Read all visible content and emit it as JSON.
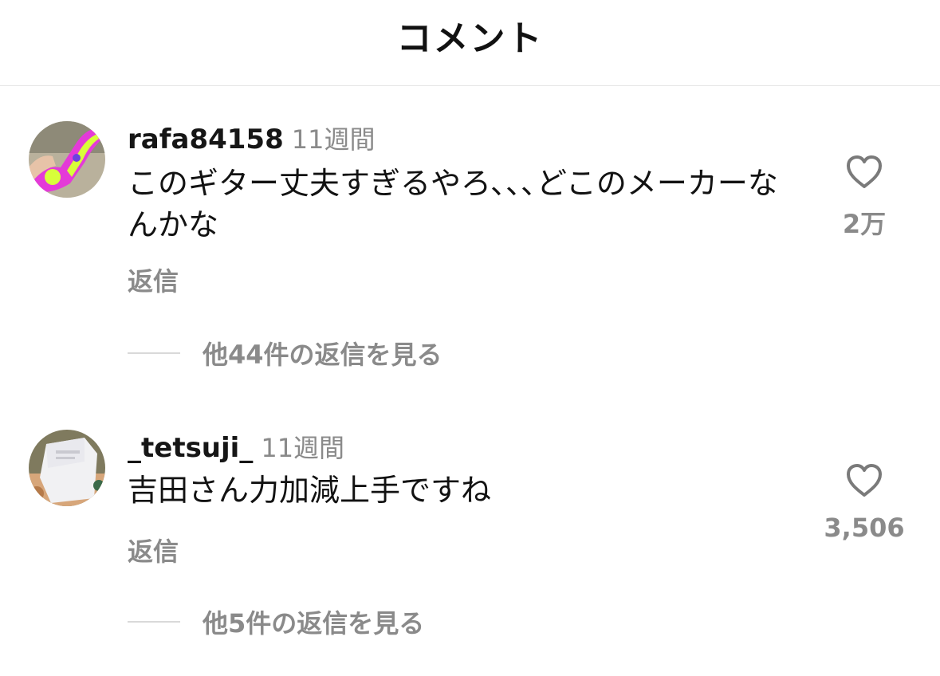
{
  "header": {
    "title": "コメント"
  },
  "comments": [
    {
      "username": "rafa84158",
      "time": "11週間",
      "text": "このギター丈夫すぎるやろ､､､どこのメーカーなんかな",
      "reply_label": "返信",
      "more_replies": "他44件の返信を見る",
      "like_count": "2万",
      "like_icon": "heart-outline-icon"
    },
    {
      "username": "_tetsuji_",
      "time": "11週間",
      "text": "吉田さん力加減上手ですね",
      "reply_label": "返信",
      "more_replies": "他5件の返信を見る",
      "like_count": "3,506",
      "like_icon": "heart-outline-icon"
    }
  ]
}
